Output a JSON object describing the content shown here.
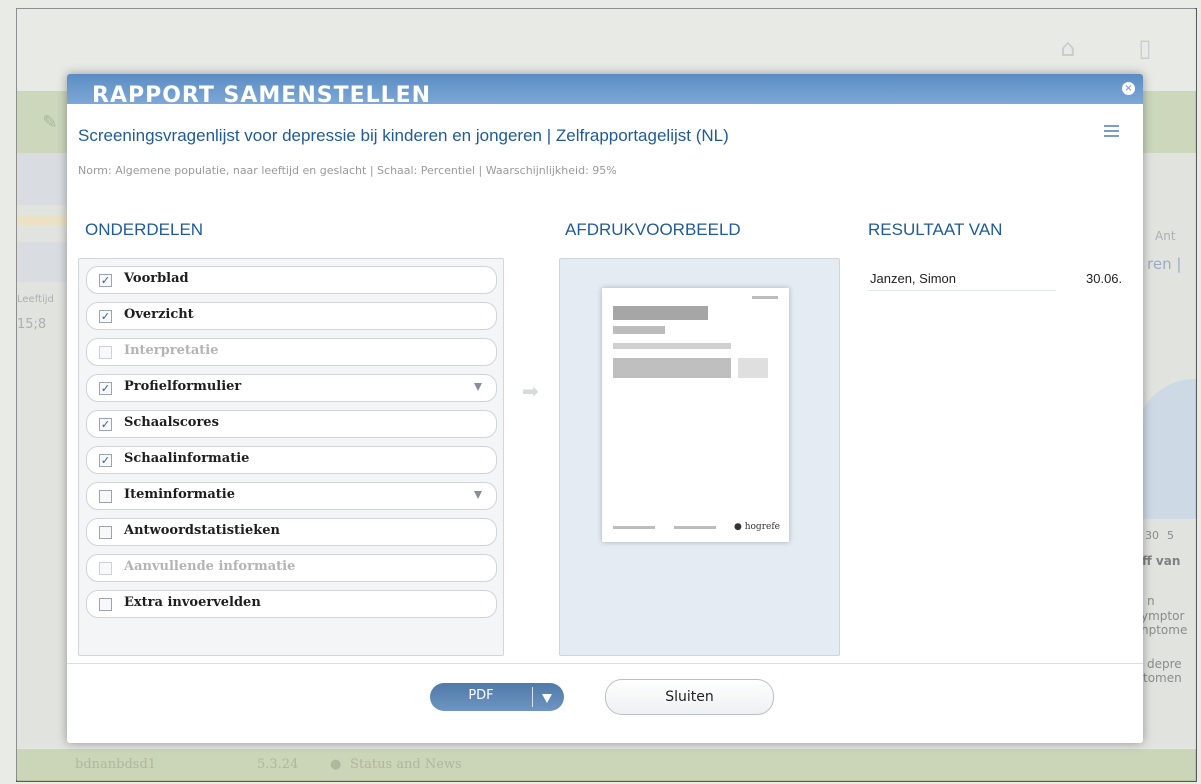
{
  "background": {
    "left_labels": [
      "Leeftijd",
      "15;8"
    ],
    "right_labels": [
      "Ant",
      "ren |",
      "30",
      "5",
      "ff van",
      "n",
      "ymptor",
      "nptome",
      "depre",
      "tomen"
    ],
    "status_bar": {
      "user": "bdnanbdsd1",
      "version": "5.3.24",
      "status_link": "Status and News"
    }
  },
  "modal": {
    "title": "RAPPORT SAMENSTELLEN",
    "subtitle": "Screeningsvragenlijst voor depressie bij kinderen en jongeren | Zelfrapportagelijst (NL)",
    "norm_line": "Norm: Algemene populatie, naar leeftijd en geslacht | Schaal: Percentiel | Waarschijnlijkheid: 95%"
  },
  "sections": {
    "parts_heading": "ONDERDELEN",
    "preview_heading": "AFDRUKVOORBEELD",
    "result_heading": "RESULTAAT VAN"
  },
  "parts": [
    {
      "label": "Voorblad",
      "checked": true,
      "disabled": false,
      "dropdown": false
    },
    {
      "label": "Overzicht",
      "checked": true,
      "disabled": false,
      "dropdown": false
    },
    {
      "label": "Interpretatie",
      "checked": false,
      "disabled": true,
      "dropdown": false
    },
    {
      "label": "Profielformulier",
      "checked": true,
      "disabled": false,
      "dropdown": true
    },
    {
      "label": "Schaalscores",
      "checked": true,
      "disabled": false,
      "dropdown": false
    },
    {
      "label": "Schaalinformatie",
      "checked": true,
      "disabled": false,
      "dropdown": false
    },
    {
      "label": "Iteminformatie",
      "checked": false,
      "disabled": false,
      "dropdown": true
    },
    {
      "label": "Antwoordstatistieken",
      "checked": false,
      "disabled": false,
      "dropdown": false
    },
    {
      "label": "Aanvullende informatie",
      "checked": false,
      "disabled": true,
      "dropdown": false
    },
    {
      "label": "Extra invoervelden",
      "checked": false,
      "disabled": false,
      "dropdown": false
    }
  ],
  "preview": {
    "logo": "hogrefe"
  },
  "result": {
    "name": "Janzen, Simon",
    "date": "30.06."
  },
  "buttons": {
    "pdf": "PDF",
    "close": "Sluiten"
  },
  "icons": {
    "checkbox_checked": "☑",
    "arrow": "➡",
    "close": "×"
  }
}
